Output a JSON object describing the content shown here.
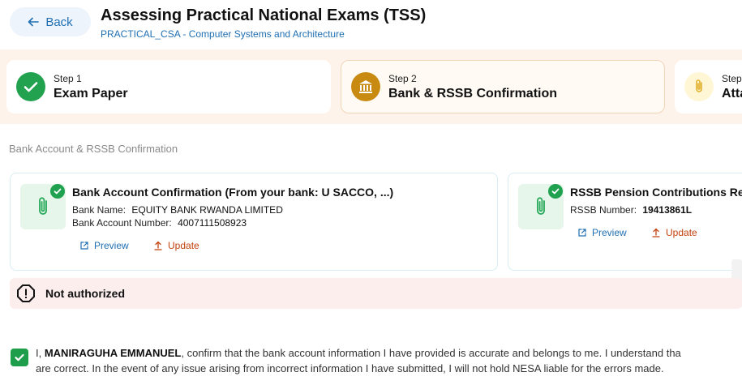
{
  "header": {
    "back_label": "Back",
    "title": "Assessing Practical National Exams (TSS)",
    "subtitle": "PRACTICAL_CSA - Computer Systems and Architecture"
  },
  "steps": [
    {
      "number": "Step 1",
      "label": "Exam Paper",
      "icon": "check-icon",
      "status": "completed",
      "color": "#22a14f"
    },
    {
      "number": "Step 2",
      "label": "Bank & RSSB Confirmation",
      "icon": "bank-icon",
      "status": "active",
      "color": "#c98a12"
    },
    {
      "number": "Step",
      "label": "Atta",
      "icon": "paperclip-icon",
      "status": "pending",
      "color": "#e9c44a"
    }
  ],
  "section": {
    "title": "Bank Account & RSSB Confirmation"
  },
  "bank_card": {
    "title": "Bank Account Confirmation (From your bank: U SACCO, ...)",
    "bank_name_label": "Bank Name:",
    "bank_name": "EQUITY BANK RWANDA LIMITED",
    "account_label": "Bank Account Number:",
    "account_number": "4007111508923",
    "preview_label": "Preview",
    "update_label": "Update"
  },
  "rssb_card": {
    "title": "RSSB Pension Contributions Rep",
    "rssb_label": "RSSB Number:",
    "rssb_number": "19413861L",
    "preview_label": "Preview",
    "update_label": "Update"
  },
  "alert": {
    "text": "Not authorized"
  },
  "confirmation": {
    "checked": true,
    "prefix": "I, ",
    "name": "MANIRAGUHA EMMANUEL",
    "line1_rest": ", confirm that the bank account information I have provided is accurate and belongs to me. I understand tha",
    "line2": "are correct. In the event of any issue arising from incorrect information I have submitted, I will not hold NESA liable for the errors made."
  },
  "colors": {
    "accent": "#1f6fb2",
    "success": "#1fa14f",
    "warning": "#c2410c",
    "steps_bg": "#fdf3ea",
    "alert_bg": "#fdeeee"
  }
}
